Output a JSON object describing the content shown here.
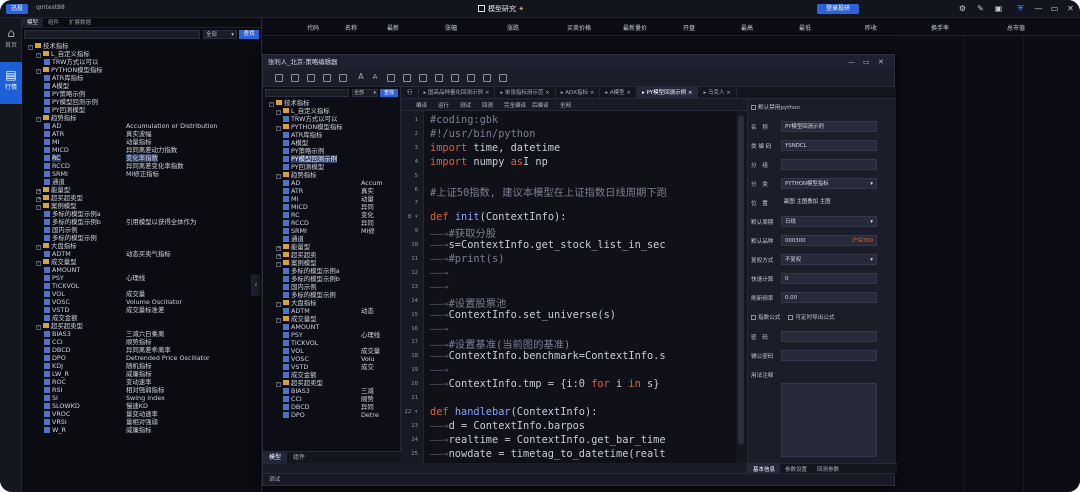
{
  "topbar": {
    "logo": "迅投",
    "account": "qmtest88",
    "title": "模型研究",
    "login_label": "登录投研"
  },
  "rail": [
    {
      "icon": "home-icon",
      "label": "首页"
    },
    {
      "icon": "chart-icon",
      "label": "行情"
    }
  ],
  "left_panel": {
    "tabs": [
      "模型",
      "组件",
      "扩展数据"
    ],
    "search_select": "全部",
    "search_button": "查找",
    "tree": [
      {
        "lvl": 1,
        "t": "f",
        "ex": "-",
        "name": "技术指标"
      },
      {
        "lvl": 2,
        "t": "f",
        "ex": "-",
        "name": "L_自定义指标"
      },
      {
        "lvl": 3,
        "t": "l",
        "name": "TRW方式以可以"
      },
      {
        "lvl": 2,
        "t": "f",
        "ex": "-",
        "name": "PYTHON模型指标"
      },
      {
        "lvl": 3,
        "t": "l",
        "name": "ATR库指标"
      },
      {
        "lvl": 3,
        "t": "l",
        "name": "A模型"
      },
      {
        "lvl": 3,
        "t": "l",
        "name": "PY策略示例"
      },
      {
        "lvl": 3,
        "t": "l",
        "name": "PY模型回测示例"
      },
      {
        "lvl": 3,
        "t": "l",
        "name": "PY回测模型"
      },
      {
        "lvl": 2,
        "t": "f",
        "ex": "-",
        "name": "趋势指标"
      },
      {
        "lvl": 3,
        "t": "l",
        "name": "AD",
        "desc": "Accumulation or Distribution"
      },
      {
        "lvl": 3,
        "t": "l",
        "name": "ATR",
        "desc": "真实波幅"
      },
      {
        "lvl": 3,
        "t": "l",
        "name": "MI",
        "desc": "动量指标"
      },
      {
        "lvl": 3,
        "t": "l",
        "name": "MICD",
        "desc": "异同离差动力指数"
      },
      {
        "lvl": 3,
        "t": "l",
        "name": "RC",
        "desc": "变化率指数",
        "sel": true
      },
      {
        "lvl": 3,
        "t": "l",
        "name": "RCCD",
        "desc": "异同离差变化率指数"
      },
      {
        "lvl": 3,
        "t": "l",
        "name": "SRMI",
        "desc": "MI修正指标"
      },
      {
        "lvl": 3,
        "t": "l",
        "name": "通道"
      },
      {
        "lvl": 2,
        "t": "f",
        "ex": "+",
        "name": "能量型"
      },
      {
        "lvl": 2,
        "t": "f",
        "ex": "+",
        "name": "超买超卖型"
      },
      {
        "lvl": 2,
        "t": "f",
        "ex": "-",
        "name": "案例模型"
      },
      {
        "lvl": 3,
        "t": "l",
        "name": "多标的模型示例a"
      },
      {
        "lvl": 3,
        "t": "l",
        "name": "多标的模型示例b",
        "desc": "引用模型以获得全体作为"
      },
      {
        "lvl": 3,
        "t": "l",
        "name": "国内示例"
      },
      {
        "lvl": 3,
        "t": "l",
        "name": "多标的模型示例"
      },
      {
        "lvl": 2,
        "t": "f",
        "ex": "-",
        "name": "大盘指标"
      },
      {
        "lvl": 3,
        "t": "l",
        "name": "ADTM",
        "desc": "动态买卖气指标"
      },
      {
        "lvl": 2,
        "t": "f",
        "ex": "-",
        "name": "成交量型"
      },
      {
        "lvl": 3,
        "t": "l",
        "name": "AMOUNT"
      },
      {
        "lvl": 3,
        "t": "l",
        "name": "PSY",
        "desc": "心理线"
      },
      {
        "lvl": 3,
        "t": "l",
        "name": "TICKVOL"
      },
      {
        "lvl": 3,
        "t": "l",
        "name": "VOL",
        "desc": "成交量"
      },
      {
        "lvl": 3,
        "t": "l",
        "name": "VOSC",
        "desc": "Volume Oscillator"
      },
      {
        "lvl": 3,
        "t": "l",
        "name": "VSTD",
        "desc": "成交量标准差"
      },
      {
        "lvl": 3,
        "t": "l",
        "name": "成交金额"
      },
      {
        "lvl": 2,
        "t": "f",
        "ex": "-",
        "name": "超买超卖型"
      },
      {
        "lvl": 3,
        "t": "l",
        "name": "BIAS3",
        "desc": "三减六日乘离"
      },
      {
        "lvl": 3,
        "t": "l",
        "name": "CCI",
        "desc": "顺势指标"
      },
      {
        "lvl": 3,
        "t": "l",
        "name": "DBCD",
        "desc": "异同离差乖离率"
      },
      {
        "lvl": 3,
        "t": "l",
        "name": "DPO",
        "desc": "Detrended Price Oscillator"
      },
      {
        "lvl": 3,
        "t": "l",
        "name": "KDJ",
        "desc": "随机指标"
      },
      {
        "lvl": 3,
        "t": "l",
        "name": "LW_R",
        "desc": "威廉指标"
      },
      {
        "lvl": 3,
        "t": "l",
        "name": "ROC",
        "desc": "变动速率"
      },
      {
        "lvl": 3,
        "t": "l",
        "name": "RSI",
        "desc": "相对强弱指标"
      },
      {
        "lvl": 3,
        "t": "l",
        "name": "SI",
        "desc": "Swing Index"
      },
      {
        "lvl": 3,
        "t": "l",
        "name": "SLOWKD",
        "desc": "慢速KD"
      },
      {
        "lvl": 3,
        "t": "l",
        "name": "VROC",
        "desc": "量变动速率"
      },
      {
        "lvl": 3,
        "t": "l",
        "name": "VRSI",
        "desc": "量相对强弱"
      },
      {
        "lvl": 3,
        "t": "l",
        "name": "W_R",
        "desc": "威廉指标"
      }
    ]
  },
  "market_header": [
    "代码",
    "名称",
    "最新",
    "涨幅",
    "涨跌",
    "买卖价格",
    "最新量价",
    "开盘",
    "最高",
    "最低",
    "昨收",
    "换手率",
    "总市值"
  ],
  "editor": {
    "title": "张利人_北京-策略编辑器",
    "window_buttons": [
      "—",
      "▭",
      "✕"
    ],
    "tree_search_select": "全部",
    "tree_search_button": "查找",
    "tree": [
      {
        "lvl": 1,
        "t": "f",
        "ex": "-",
        "name": "技术指标"
      },
      {
        "lvl": 2,
        "t": "f",
        "ex": "-",
        "name": "L_自定义指标"
      },
      {
        "lvl": 3,
        "t": "l",
        "name": "TRW方式以可以"
      },
      {
        "lvl": 2,
        "t": "f",
        "ex": "-",
        "name": "PYTHON模型指标"
      },
      {
        "lvl": 3,
        "t": "l",
        "name": "ATR库指标"
      },
      {
        "lvl": 3,
        "t": "l",
        "name": "A模型"
      },
      {
        "lvl": 3,
        "t": "l",
        "name": "PY策略示例"
      },
      {
        "lvl": 3,
        "t": "l",
        "name": "PY模型回测示例",
        "sel": true
      },
      {
        "lvl": 3,
        "t": "l",
        "name": "PY回测模型"
      },
      {
        "lvl": 2,
        "t": "f",
        "ex": "-",
        "name": "趋势指标"
      },
      {
        "lvl": 3,
        "t": "l",
        "name": "AD",
        "desc": "Accum"
      },
      {
        "lvl": 3,
        "t": "l",
        "name": "ATR",
        "desc": "真实"
      },
      {
        "lvl": 3,
        "t": "l",
        "name": "MI",
        "desc": "动量"
      },
      {
        "lvl": 3,
        "t": "l",
        "name": "MICD",
        "desc": "异同"
      },
      {
        "lvl": 3,
        "t": "l",
        "name": "RC",
        "desc": "变化"
      },
      {
        "lvl": 3,
        "t": "l",
        "name": "RCCD",
        "desc": "异同"
      },
      {
        "lvl": 3,
        "t": "l",
        "name": "SRMI",
        "desc": "MI修"
      },
      {
        "lvl": 3,
        "t": "l",
        "name": "通道"
      },
      {
        "lvl": 2,
        "t": "f",
        "ex": "+",
        "name": "能量型"
      },
      {
        "lvl": 2,
        "t": "f",
        "ex": "+",
        "name": "超买超卖"
      },
      {
        "lvl": 2,
        "t": "f",
        "ex": "-",
        "name": "案例模型"
      },
      {
        "lvl": 3,
        "t": "l",
        "name": "多标的模型示例a"
      },
      {
        "lvl": 3,
        "t": "l",
        "name": "多标的模型示例b"
      },
      {
        "lvl": 3,
        "t": "l",
        "name": "国内示例"
      },
      {
        "lvl": 3,
        "t": "l",
        "name": "多标的模型示例"
      },
      {
        "lvl": 2,
        "t": "f",
        "ex": "-",
        "name": "大盘指标"
      },
      {
        "lvl": 3,
        "t": "l",
        "name": "ADTM",
        "desc": "动态"
      },
      {
        "lvl": 2,
        "t": "f",
        "ex": "-",
        "name": "成交量型"
      },
      {
        "lvl": 3,
        "t": "l",
        "name": "AMOUNT"
      },
      {
        "lvl": 3,
        "t": "l",
        "name": "PSY",
        "desc": "心理线"
      },
      {
        "lvl": 3,
        "t": "l",
        "name": "TICKVOL"
      },
      {
        "lvl": 3,
        "t": "l",
        "name": "VOL",
        "desc": "成交量"
      },
      {
        "lvl": 3,
        "t": "l",
        "name": "VOSC",
        "desc": "Volu"
      },
      {
        "lvl": 3,
        "t": "l",
        "name": "VSTD",
        "desc": "成交"
      },
      {
        "lvl": 3,
        "t": "l",
        "name": "成交金额"
      },
      {
        "lvl": 2,
        "t": "f",
        "ex": "-",
        "name": "超买超卖型"
      },
      {
        "lvl": 3,
        "t": "l",
        "name": "BIAS3",
        "desc": "三减"
      },
      {
        "lvl": 3,
        "t": "l",
        "name": "CCI",
        "desc": "顺势"
      },
      {
        "lvl": 3,
        "t": "l",
        "name": "DBCD",
        "desc": "异同"
      },
      {
        "lvl": 3,
        "t": "l",
        "name": "DPO",
        "desc": "Detre"
      }
    ],
    "tree_tabs": [
      "模型",
      "组件"
    ],
    "tabs": [
      "行",
      "国高品种量化回测示例",
      "单张指标测示范",
      "ADX指标",
      "A模型",
      "PY模型回测示例",
      "马克人"
    ],
    "sub_buttons": [
      "编译",
      "运行",
      "测试",
      "回测",
      "完全编译",
      "后编译",
      "全网"
    ],
    "code_lines": [
      {
        "n": "1",
        "segs": [
          {
            "c": "cmt",
            "t": "#coding:gbk"
          }
        ]
      },
      {
        "n": "2",
        "segs": [
          {
            "c": "cmt",
            "t": "#!/usr/bin/python"
          }
        ]
      },
      {
        "n": "3",
        "segs": [
          {
            "c": "kw",
            "t": "import"
          },
          {
            "c": "",
            "t": " time, datetime"
          }
        ]
      },
      {
        "n": "4",
        "segs": [
          {
            "c": "kw",
            "t": "import"
          },
          {
            "c": "",
            "t": " numpy "
          },
          {
            "c": "kw",
            "t": "as"
          },
          {
            "c": "",
            "t": "I np"
          }
        ]
      },
      {
        "n": "5",
        "segs": []
      },
      {
        "n": "6",
        "segs": [
          {
            "c": "cmt",
            "t": "#上证50指数, 建议本模型在上证指数日线周期下跑"
          }
        ]
      },
      {
        "n": "7",
        "segs": []
      },
      {
        "n": "8",
        "fold": true,
        "segs": [
          {
            "c": "kw",
            "t": "def"
          },
          {
            "c": "",
            "t": " "
          },
          {
            "c": "fn",
            "t": "init"
          },
          {
            "c": "",
            "t": "(ContextInfo):"
          }
        ]
      },
      {
        "n": "9",
        "segs": [
          {
            "c": "ar",
            "t": "——→"
          },
          {
            "c": "cmt",
            "t": "#获取分股"
          }
        ]
      },
      {
        "n": "10",
        "segs": [
          {
            "c": "ar",
            "t": "——→"
          },
          {
            "c": "",
            "t": "s=ContextInfo.get_stock_list_in_sec"
          }
        ]
      },
      {
        "n": "11",
        "segs": [
          {
            "c": "ar",
            "t": "——→"
          },
          {
            "c": "cmt",
            "t": "#print(s)"
          }
        ]
      },
      {
        "n": "12",
        "segs": [
          {
            "c": "ar",
            "t": "——→"
          }
        ]
      },
      {
        "n": "13",
        "segs": [
          {
            "c": "ar",
            "t": "——→"
          }
        ]
      },
      {
        "n": "14",
        "segs": [
          {
            "c": "ar",
            "t": "——→"
          },
          {
            "c": "cmt",
            "t": "#设置股票池"
          }
        ]
      },
      {
        "n": "15",
        "segs": [
          {
            "c": "ar",
            "t": "——→"
          },
          {
            "c": "",
            "t": "ContextInfo.set_universe(s)"
          }
        ]
      },
      {
        "n": "16",
        "segs": [
          {
            "c": "ar",
            "t": "——→"
          }
        ]
      },
      {
        "n": "17",
        "segs": [
          {
            "c": "ar",
            "t": "——→"
          },
          {
            "c": "cmt",
            "t": "#设置基准(当前图的基准)"
          }
        ]
      },
      {
        "n": "18",
        "segs": [
          {
            "c": "ar",
            "t": "——→"
          },
          {
            "c": "",
            "t": "ContextInfo.benchmark=ContextInfo.s"
          }
        ]
      },
      {
        "n": "19",
        "segs": [
          {
            "c": "ar",
            "t": "——→"
          }
        ]
      },
      {
        "n": "20",
        "segs": [
          {
            "c": "ar",
            "t": "——→"
          },
          {
            "c": "",
            "t": "ContextInfo.tmp = {i:0 "
          },
          {
            "c": "kw",
            "t": "for"
          },
          {
            "c": "",
            "t": " i "
          },
          {
            "c": "kw",
            "t": "in"
          },
          {
            "c": "",
            "t": " s}"
          }
        ]
      },
      {
        "n": "21",
        "segs": []
      },
      {
        "n": "22",
        "fold": true,
        "segs": [
          {
            "c": "kw",
            "t": "def"
          },
          {
            "c": "",
            "t": " "
          },
          {
            "c": "fn",
            "t": "handlebar"
          },
          {
            "c": "",
            "t": "(ContextInfo):"
          }
        ]
      },
      {
        "n": "23",
        "segs": [
          {
            "c": "ar",
            "t": "——→"
          },
          {
            "c": "",
            "t": "d = ContextInfo.barpos"
          }
        ]
      },
      {
        "n": "24",
        "segs": [
          {
            "c": "ar",
            "t": "——→"
          },
          {
            "c": "",
            "t": "realtime = ContextInfo.get_bar_time"
          }
        ]
      },
      {
        "n": "25",
        "segs": [
          {
            "c": "ar",
            "t": "——→"
          },
          {
            "c": "",
            "t": "nowdate = timetag_to_datetime(realt"
          }
        ]
      }
    ],
    "props": {
      "header_check": "默认禁用python",
      "fields": [
        {
          "label": "名　称",
          "value": "PY模型回测示例"
        },
        {
          "label": "类 编 码",
          "value": "YSNDCL"
        },
        {
          "label": "分　组",
          "value": ""
        },
        {
          "label": "分　类",
          "value": "PYTHON模型指标"
        },
        {
          "label": "位　置",
          "value": "副图  主图叠加  主图"
        },
        {
          "label": "默认周期",
          "value": "日线"
        },
        {
          "label": "默认品种",
          "value": "000300",
          "tag": "沪深300"
        },
        {
          "label": "复权方式",
          "value": "不复权"
        },
        {
          "label": "快速计算",
          "value": "0"
        },
        {
          "label": "刷新频率",
          "value": "0.00"
        }
      ],
      "checks": [
        "指数公式",
        "可定时导出公式"
      ],
      "pwd_label": "密　码",
      "ext_label": "辅公密码",
      "desc_label": "用法注释",
      "tabs": [
        "基本信息",
        "参数设置",
        "回测参数"
      ]
    },
    "status": "调试"
  }
}
